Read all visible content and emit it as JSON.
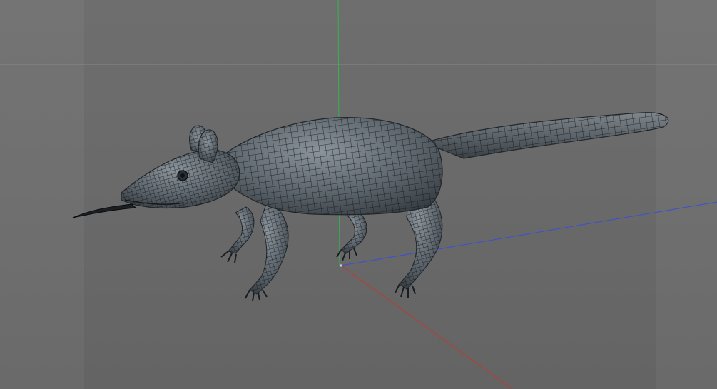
{
  "viewport": {
    "background_color": "#6c6c6c",
    "axis_colors": {
      "x": "#c0392b",
      "y": "#2ecc40",
      "z": "#3b4fd0"
    },
    "mesh_color": "#3a4045",
    "wire_color": "#0d1012",
    "object_icon": "animal-wireframe-model"
  }
}
